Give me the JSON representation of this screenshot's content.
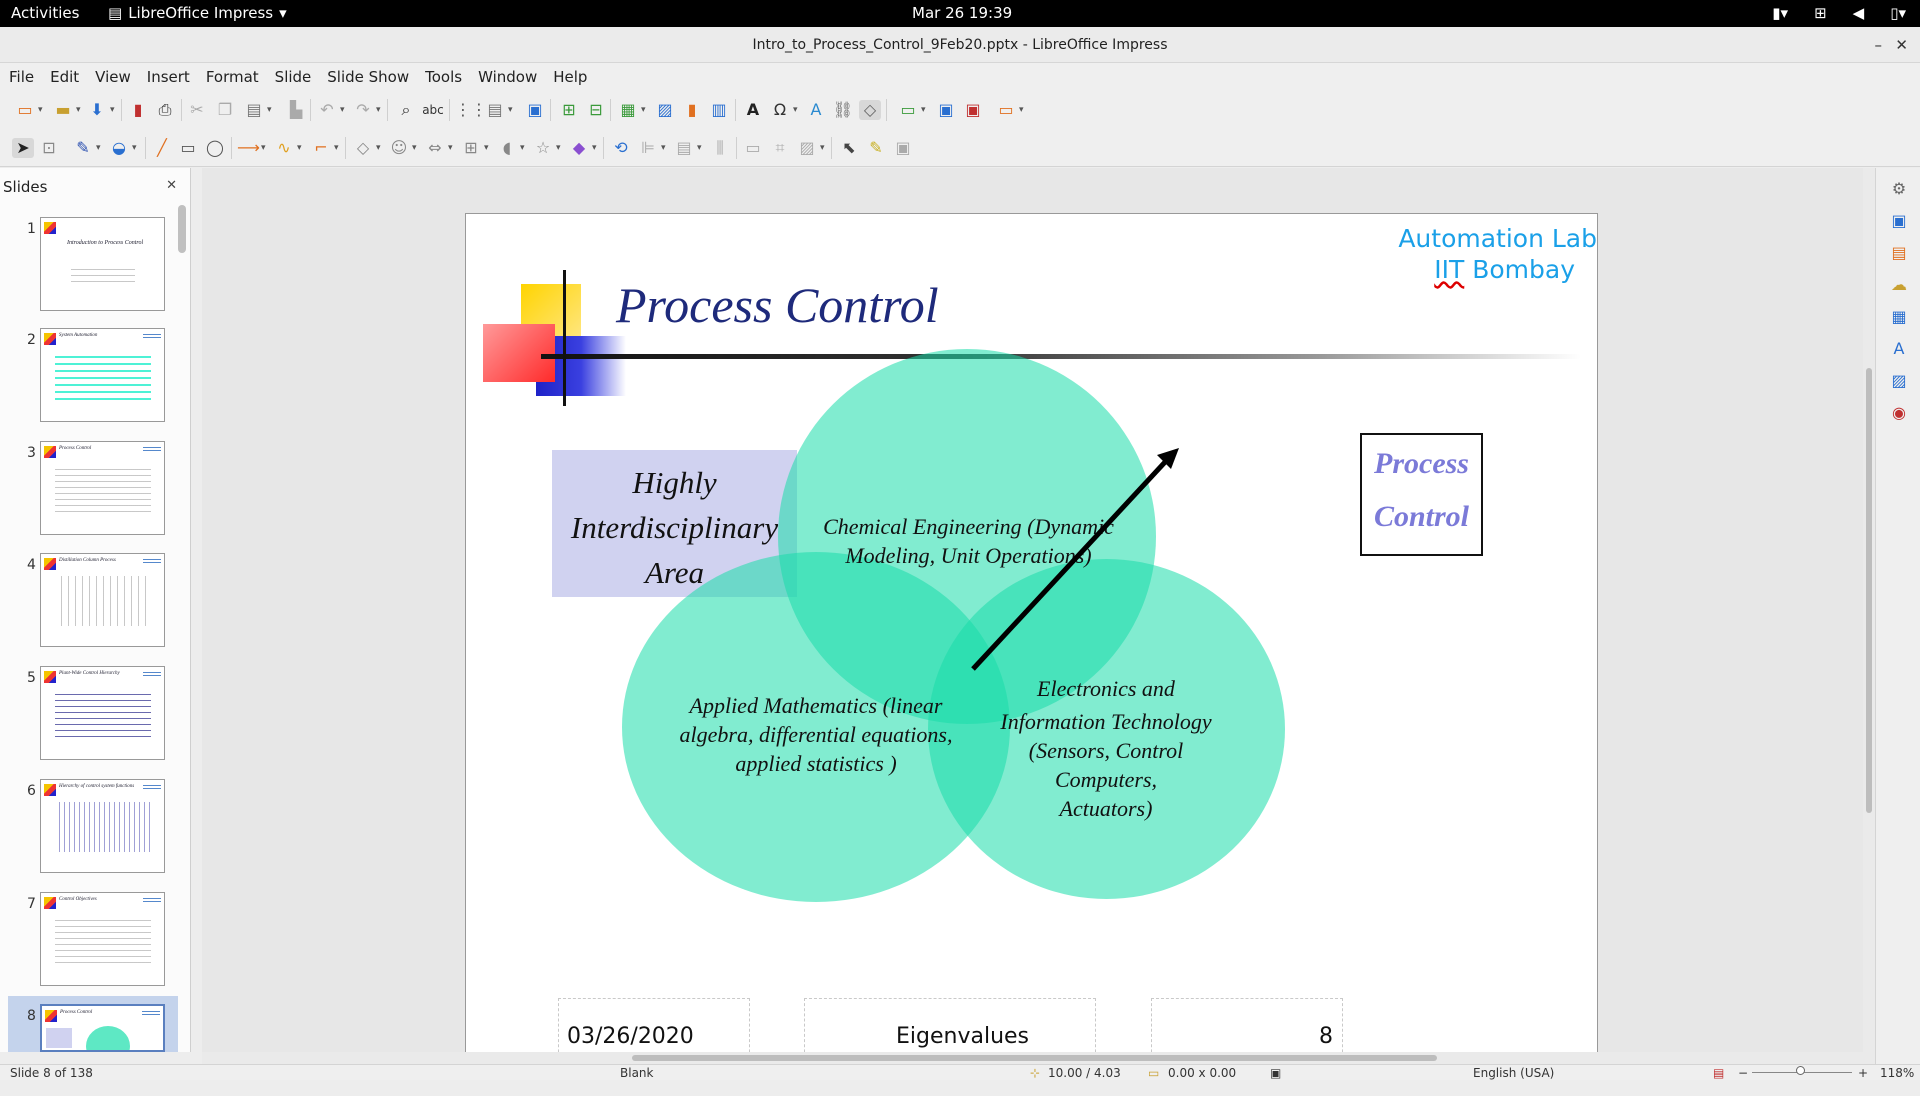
{
  "topbar": {
    "activities": "Activities",
    "app": "LibreOffice Impress",
    "clock": "Mar 26  19:39"
  },
  "window": {
    "title": "Intro_to_Process_Control_9Feb20.pptx - LibreOffice Impress"
  },
  "menu": [
    "File",
    "Edit",
    "View",
    "Insert",
    "Format",
    "Slide",
    "Slide Show",
    "Tools",
    "Window",
    "Help"
  ],
  "slides_panel": {
    "header": "Slides",
    "thumbnails": [
      {
        "num": "1",
        "title": "Introduction to Process Control"
      },
      {
        "num": "2",
        "title": "System Automation"
      },
      {
        "num": "3",
        "title": "Process Control"
      },
      {
        "num": "4",
        "title": "Distillation Column Process"
      },
      {
        "num": "5",
        "title": "Plant-Wide Control Hierarchy"
      },
      {
        "num": "6",
        "title": "Hierarchy of control system functions"
      },
      {
        "num": "7",
        "title": "Control Objectives"
      },
      {
        "num": "8",
        "title": "Process Control"
      }
    ]
  },
  "slide": {
    "lab_line1": "Automation Lab",
    "lab_line2_a": "IIT",
    "lab_line2_b": " Bombay",
    "title": "Process Control",
    "box_text_1": "Highly",
    "box_text_2": "Interdisciplinary",
    "box_text_3": "Area",
    "circle_top_1": "Chemical Engineering (Dynamic",
    "circle_top_2": "Modeling, Unit Operations)",
    "circle_left_1": "Applied Mathematics (linear",
    "circle_left_2": "algebra, differential equations,",
    "circle_left_3": "applied statistics )",
    "circle_right_1": "Electronics and",
    "circle_right_2": "Information Technology",
    "circle_right_3": "(Sensors, Control Computers,",
    "circle_right_4": "Actuators)",
    "pc_1": "Process",
    "pc_2": "Control",
    "footer_date": "03/26/2020",
    "footer_center": "Eigenvalues",
    "footer_page": "8"
  },
  "statusbar": {
    "slide": "Slide 8 of 138",
    "layout": "Blank",
    "position": "10.00 / 4.03",
    "size": "0.00 x 0.00",
    "language": "English (USA)",
    "zoom": "118%"
  },
  "colors": {
    "circle": "#19ddaa",
    "title": "#1e2a7b",
    "lab": "#1aa0e8",
    "pc_text": "#7b7ad8",
    "hia_bg": "#d0d2f0"
  }
}
